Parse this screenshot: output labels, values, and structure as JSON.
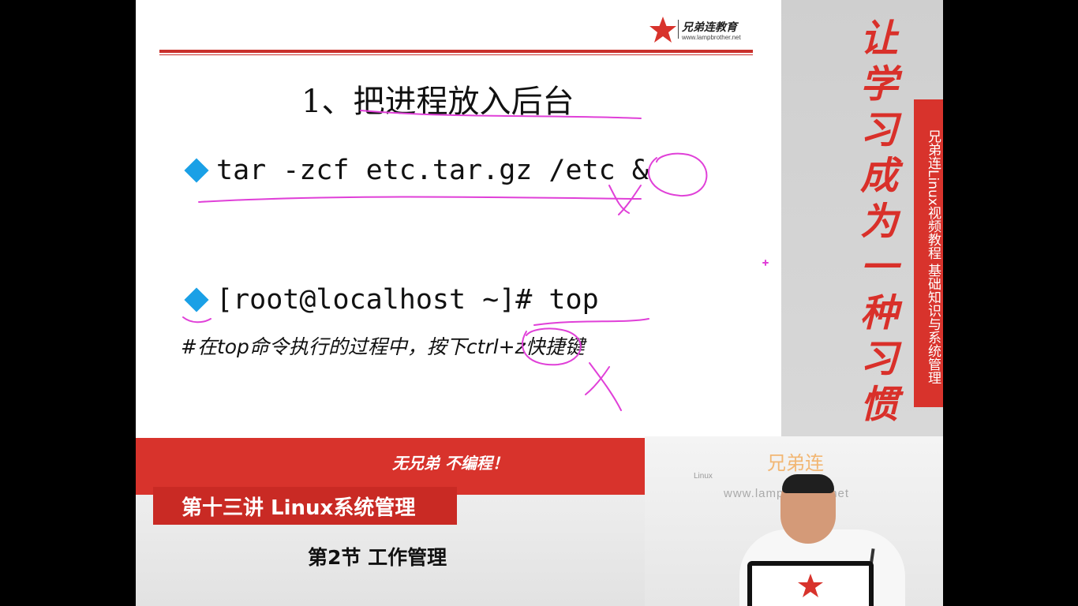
{
  "slide": {
    "logo_brand": "兄弟连教育",
    "logo_url": "www.lampbrother.net",
    "heading": "1、把进程放入后台",
    "command1": "tar -zcf etc.tar.gz /etc &",
    "command2": "[root@localhost ~]# top",
    "note": "#在top命令执行的过程中，按下ctrl+z快捷键"
  },
  "right_panel": {
    "slogan": "让学习成为一种习惯",
    "series": "兄弟连Linux视频教程  基础知识与系统管理"
  },
  "lower_third": {
    "tagline": "无兄弟 不编程！",
    "lecture": "第十三讲 Linux系统管理",
    "section": "第2节 工作管理"
  },
  "webcam": {
    "brand": "兄弟连",
    "linux_label": "Linux",
    "url": "www.lampbrother.net"
  },
  "colors": {
    "accent_red": "#d8332c",
    "bullet_blue": "#1aa0e6",
    "annotation_pink": "#e040d8"
  },
  "icons": [
    "red-star-logo-icon",
    "diamond-bullet-icon"
  ]
}
